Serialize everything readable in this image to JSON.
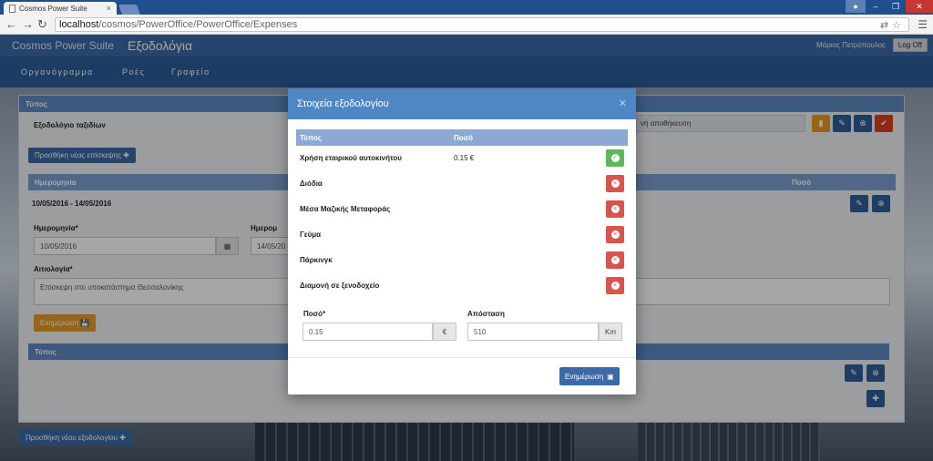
{
  "browser": {
    "tab_title": "Cosmos Power Suite",
    "url_host": "localhost",
    "url_path": "/cosmos/PowerOffice/PowerOffice/Expenses"
  },
  "header": {
    "brand": "Cosmos Power Suite",
    "section": "Εξοδολόγια",
    "user": "Μάριος Πετρόπουλος",
    "logoff": "Log Off"
  },
  "nav": {
    "items": [
      "Οργανόγραμμα",
      "Ροές",
      "Γραφείο"
    ]
  },
  "form": {
    "type_header": "Τύπος",
    "report_name": "Εξοδολόγιο ταξιδίων",
    "save_placeholder": "νή αποθήκευση",
    "add_visit_label": "Προσθήκη νέας επίσκεψης",
    "visits_col_date": "Ημερομηνία",
    "visits_col_amount": "Ποσό",
    "visit_range": "10/05/2016 - 14/05/2016",
    "date_from_label": "Ημερομηνία*",
    "date_from_value": "10/05/2016",
    "date_to_label": "Ημερομ",
    "date_to_value": "14/05/20",
    "reason_label": "Αιτιολογία*",
    "reason_value": "Επίσκεψη στο υποκατάστημα Θεσσαλονίκης",
    "update_label": "Ενημέρωση",
    "expenses_type_header": "Τύπος",
    "add_report_label": "Προσθήκη νέου εξοδολογίου"
  },
  "modal": {
    "title": "Στοιχεία εξοδολογίου",
    "col_type": "Τύπος",
    "col_amount": "Ποσό",
    "rows": [
      {
        "type": "Χρήση εταιρικού αυτοκινήτου",
        "amount": "0.15 €",
        "state": "selected"
      },
      {
        "type": "Διόδια",
        "amount": "",
        "state": "remove"
      },
      {
        "type": "Μέσα Μαζικής Μεταφοράς",
        "amount": "",
        "state": "remove"
      },
      {
        "type": "Γεύμα",
        "amount": "",
        "state": "remove"
      },
      {
        "type": "Πάρκινγκ",
        "amount": "",
        "state": "remove"
      },
      {
        "type": "Διαμονή σε ξενοδοχείο",
        "amount": "",
        "state": "remove"
      }
    ],
    "amount_label": "Ποσό*",
    "amount_value": "0.15",
    "amount_unit": "€",
    "distance_label": "Απόσταση",
    "distance_value": "510",
    "distance_unit": "Km",
    "update_label": "Ενημέρωση"
  },
  "colors": {
    "header": "#3c6aa7",
    "nav": "#2d5c99",
    "modal_header": "#4f86c6",
    "success": "#5cb85c",
    "danger": "#d9534f",
    "warning": "#e69b25"
  }
}
